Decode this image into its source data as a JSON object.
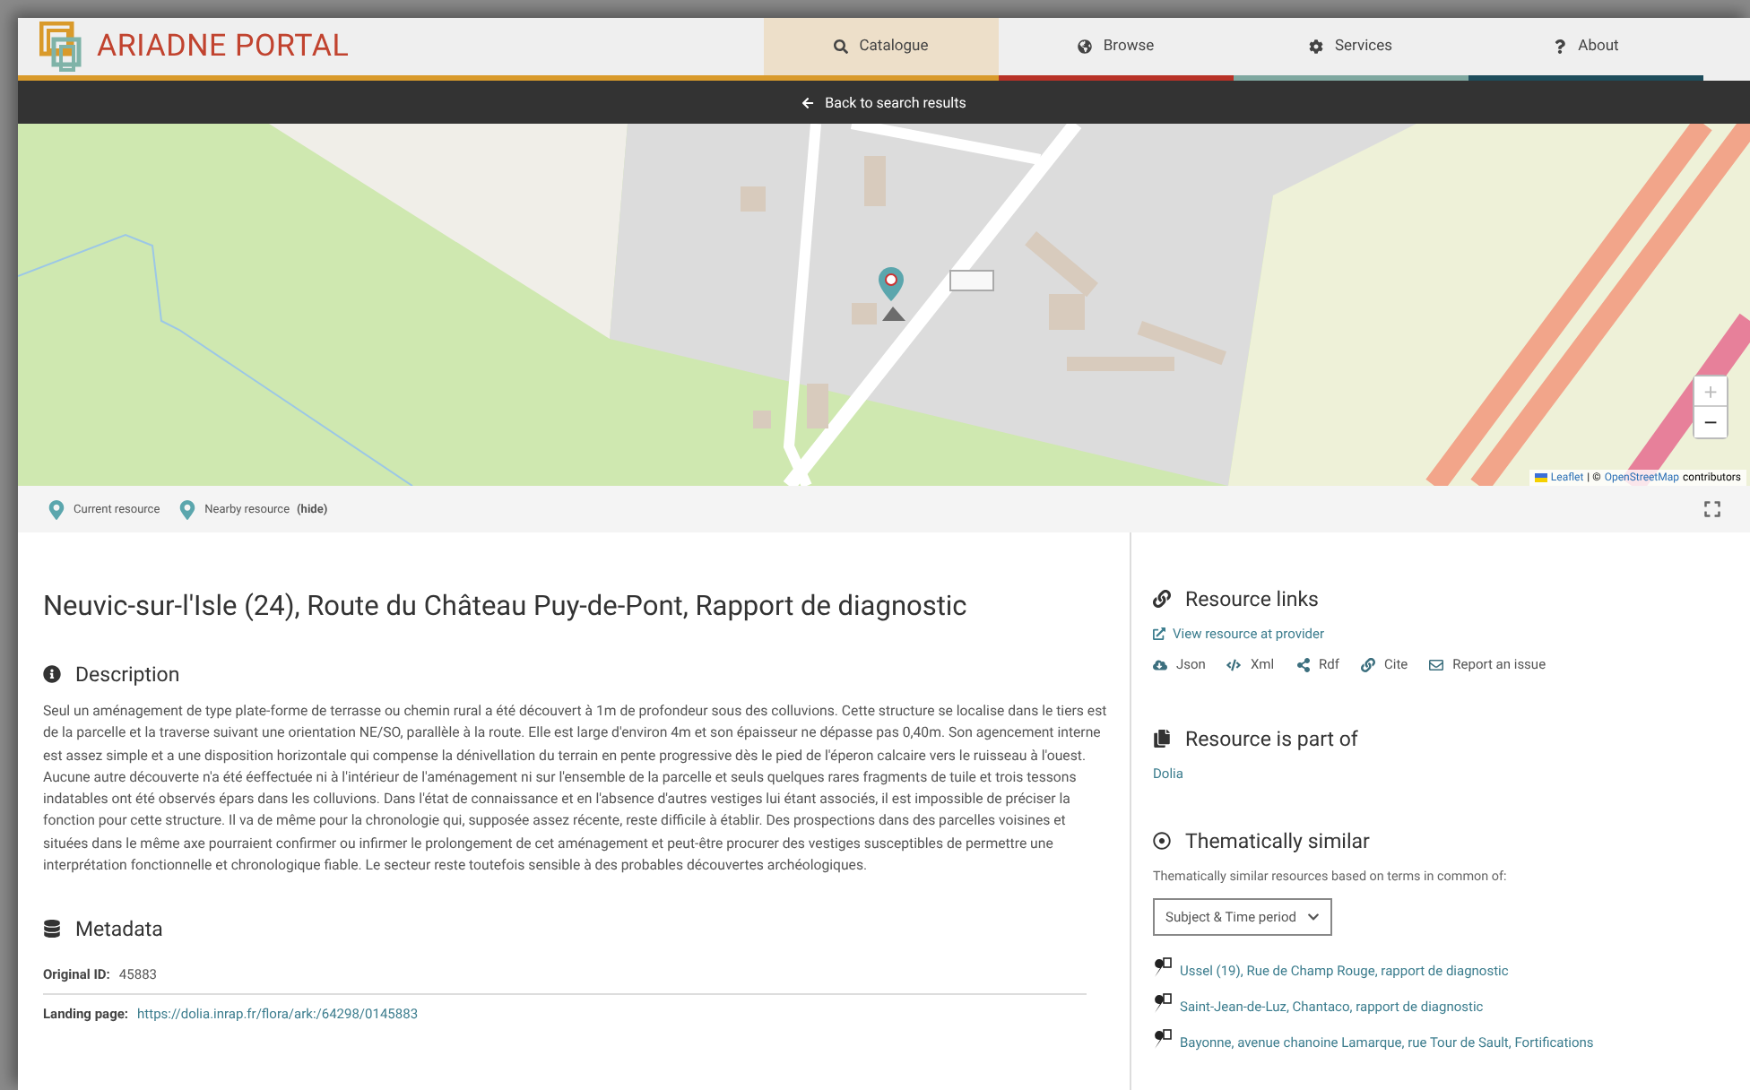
{
  "header": {
    "logo": "ARIADNE PORTAL",
    "nav": [
      {
        "label": "Catalogue",
        "kind": "search",
        "selected": true,
        "color": "#d99a2b"
      },
      {
        "label": "Browse",
        "kind": "globe",
        "selected": false,
        "color": "#b83227"
      },
      {
        "label": "Services",
        "kind": "cog",
        "selected": false,
        "color": "#7fa8a0"
      },
      {
        "label": "About",
        "kind": "question",
        "selected": false,
        "color": "#1e4d5c"
      }
    ],
    "back_link": "Back to search results"
  },
  "map": {
    "zoom_in": "+",
    "zoom_out": "−",
    "attribution": {
      "leaflet": "Leaflet",
      "separator": "| ©",
      "osm": "OpenStreetMap",
      "suffix": "contributors"
    }
  },
  "legend": {
    "current": "Current resource",
    "nearby": "Nearby resource",
    "hide": "(hide)"
  },
  "title": "Neuvic-sur-l'Isle (24), Route du Château Puy-de-Pont, Rapport de diagnostic",
  "description": {
    "heading": "Description",
    "text": "Seul un aménagement de type plate-forme de terrasse ou chemin rural a été découvert à 1m de profondeur sous des colluvions. Cette structure se localise dans le tiers est de la parcelle et la traverse suivant une orientation NE/SO, parallèle à la route. Elle est large d'environ 4m et son épaisseur ne dépasse pas 0,40m. Son agencement interne est assez simple et a une disposition horizontale qui compense la dénivellation du terrain en pente progressive dès le pied de l'éperon calcaire vers le ruisseau à l'ouest. Aucune autre découverte n'a été éeffectuée ni à l'intérieur de l'aménagement ni sur l'ensemble de la parcelle et seuls quelques rares fragments de tuile et trois tessons indatables ont été observés épars dans les colluvions. Dans l'état de connaissance et en l'absence d'autres vestiges lui étant associés, il est impossible de préciser la fonction pour cette structure. Il va de même pour la chronologie qui, supposée assez récente, reste difficile à établir. Des prospections dans des parcelles voisines et situées dans le même axe pourraient confirmer ou infirmer le prolongement de cet aménagement et peut-être procurer des vestiges susceptibles de permettre une interprétation fonctionnelle et chronologique fiable. Le secteur reste toutefois sensible à des probables découvertes archéologiques."
  },
  "metadata": {
    "heading": "Metadata",
    "rows": [
      {
        "label": "Original ID:",
        "value": "45883",
        "kind": "text"
      },
      {
        "label": "Landing page:",
        "value": "https://dolia.inrap.fr/flora/ark:/64298/0145883",
        "kind": "link"
      }
    ]
  },
  "resource_links": {
    "heading": "Resource links",
    "provider": "View resource at provider",
    "formats": [
      {
        "label": "Json",
        "kind": "json"
      },
      {
        "label": "Xml",
        "kind": "xml"
      },
      {
        "label": "Rdf",
        "kind": "rdf"
      },
      {
        "label": "Cite",
        "kind": "cite"
      },
      {
        "label": "Report an issue",
        "kind": "report"
      }
    ]
  },
  "part_of": {
    "heading": "Resource is part of",
    "items": [
      "Dolia"
    ]
  },
  "similar": {
    "heading": "Thematically similar",
    "intro": "Thematically similar resources based on terms in common of:",
    "select": "Subject & Time period",
    "items": [
      "Ussel (19), Rue de Champ Rouge, rapport de diagnostic",
      "Saint-Jean-de-Luz, Chantaco, rapport de diagnostic",
      "Bayonne, avenue chanoine Lamarque, rue Tour de Sault, Fortifications"
    ]
  }
}
